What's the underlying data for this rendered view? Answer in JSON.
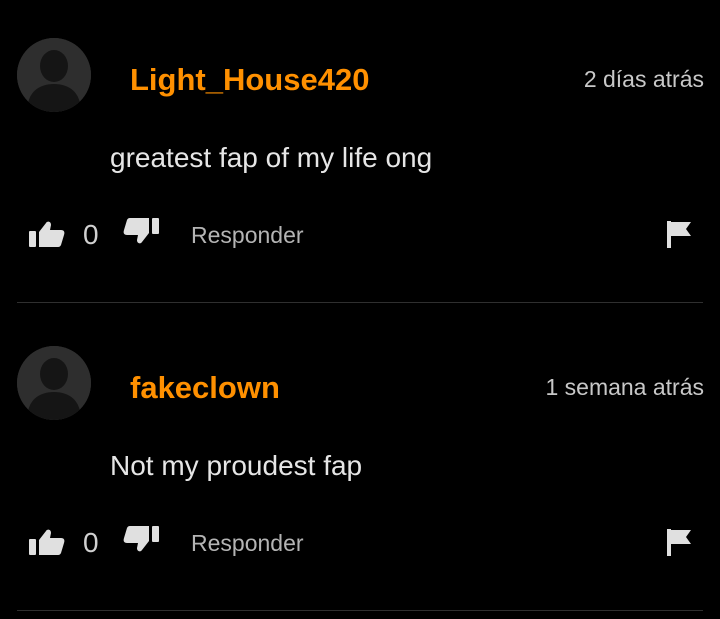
{
  "comments": [
    {
      "username": "Light_House420",
      "timestamp": "2 días atrás",
      "text": "greatest fap of my life ong",
      "likes": "0",
      "reply_label": "Responder",
      "avatar_icon": "default-user-avatar",
      "like_icon": "thumbs-up-icon",
      "dislike_icon": "thumbs-down-icon",
      "flag_icon": "flag-icon"
    },
    {
      "username": "fakeclown",
      "timestamp": "1 semana atrás",
      "text": "Not my proudest fap",
      "likes": "0",
      "reply_label": "Responder",
      "avatar_icon": "default-user-avatar",
      "like_icon": "thumbs-up-icon",
      "dislike_icon": "thumbs-down-icon",
      "flag_icon": "flag-icon"
    }
  ],
  "colors": {
    "background": "#000000",
    "username": "#ff9000",
    "text": "#e6e6e6",
    "muted": "#b4b4b4",
    "icon": "#e0e0e0",
    "avatar_bg": "#2e2e2e",
    "avatar_figure": "#151515",
    "divider": "#2f2f2f"
  }
}
